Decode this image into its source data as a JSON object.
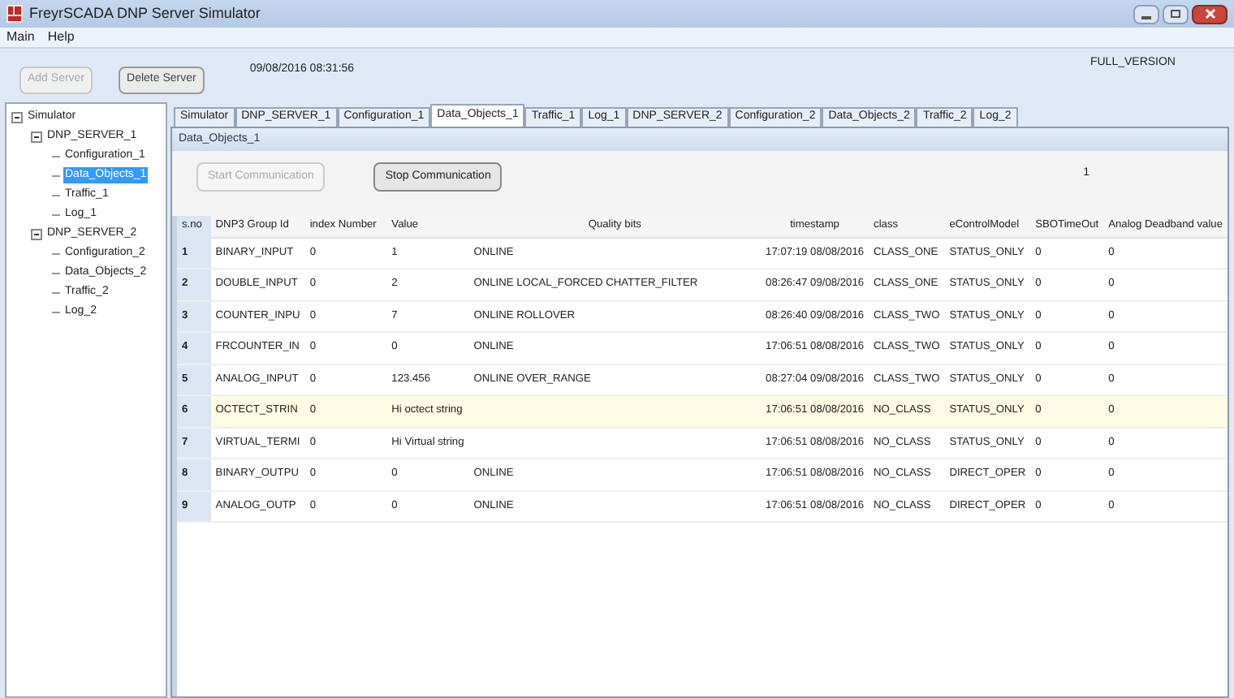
{
  "window": {
    "title": "FreyrSCADA DNP Server Simulator"
  },
  "menu": [
    "Main",
    "Help"
  ],
  "toolbar": {
    "buttons": [
      {
        "label": "Add Server",
        "disabled": true
      },
      {
        "label": "Delete Server",
        "disabled": false
      }
    ],
    "datetime": "09/08/2016 08:31:56",
    "version": "FULL_VERSION"
  },
  "tree": [
    {
      "label": "Simulator",
      "expanded": true,
      "selected": false,
      "children": [
        {
          "label": "DNP_SERVER_1",
          "expanded": true,
          "selected": false,
          "children": [
            {
              "label": "Configuration_1",
              "selected": false
            },
            {
              "label": "Data_Objects_1",
              "selected": true
            },
            {
              "label": "Traffic_1",
              "selected": false
            },
            {
              "label": "Log_1",
              "selected": false
            }
          ]
        },
        {
          "label": "DNP_SERVER_2",
          "expanded": true,
          "selected": false,
          "children": [
            {
              "label": "Configuration_2",
              "selected": false
            },
            {
              "label": "Data_Objects_2",
              "selected": false
            },
            {
              "label": "Traffic_2",
              "selected": false
            },
            {
              "label": "Log_2",
              "selected": false
            }
          ]
        }
      ]
    }
  ],
  "tabs": [
    {
      "label": "Simulator",
      "selected": false
    },
    {
      "label": "DNP_SERVER_1",
      "selected": false
    },
    {
      "label": "Configuration_1",
      "selected": false
    },
    {
      "label": "Data_Objects_1",
      "selected": true
    },
    {
      "label": "Traffic_1",
      "selected": false
    },
    {
      "label": "Log_1",
      "selected": false
    },
    {
      "label": "DNP_SERVER_2",
      "selected": false
    },
    {
      "label": "Configuration_2",
      "selected": false
    },
    {
      "label": "Data_Objects_2",
      "selected": false
    },
    {
      "label": "Traffic_2",
      "selected": false
    },
    {
      "label": "Log_2",
      "selected": false
    }
  ],
  "panel": {
    "title": "Data_Objects_1",
    "buttons": [
      {
        "label": "Start Communication",
        "disabled": true
      },
      {
        "label": "Stop Communication",
        "disabled": false
      }
    ],
    "counter": "1"
  },
  "table": {
    "columns": [
      "s.no",
      "DNP3 Group Id",
      "index Number",
      "Value",
      "Quality bits",
      "timestamp",
      "class",
      "eControlModel",
      "SBOTimeOut",
      "Analog Deadband value"
    ],
    "rows": [
      {
        "cells": [
          "1",
          "BINARY_INPUT",
          "0",
          "1",
          "ONLINE",
          "17:07:19 08/08/2016",
          "CLASS_ONE",
          "STATUS_ONLY",
          "0",
          "0"
        ],
        "selected": false
      },
      {
        "cells": [
          "2",
          "DOUBLE_INPUT",
          "0",
          "2",
          "ONLINE LOCAL_FORCED CHATTER_FILTER",
          "08:26:47 09/08/2016",
          "CLASS_ONE",
          "STATUS_ONLY",
          "0",
          "0"
        ],
        "selected": false
      },
      {
        "cells": [
          "3",
          "COUNTER_INPU",
          "0",
          "7",
          "ONLINE ROLLOVER",
          "08:26:40 09/08/2016",
          "CLASS_TWO",
          "STATUS_ONLY",
          "0",
          "0"
        ],
        "selected": false
      },
      {
        "cells": [
          "4",
          "FRCOUNTER_IN",
          "0",
          "0",
          "ONLINE",
          "17:06:51 08/08/2016",
          "CLASS_TWO",
          "STATUS_ONLY",
          "0",
          "0"
        ],
        "selected": false
      },
      {
        "cells": [
          "5",
          "ANALOG_INPUT",
          "0",
          "123.456",
          "ONLINE OVER_RANGE",
          "08:27:04 09/08/2016",
          "CLASS_TWO",
          "STATUS_ONLY",
          "0",
          "0"
        ],
        "selected": false
      },
      {
        "cells": [
          "6",
          "OCTECT_STRIN",
          "0",
          "Hi octect string",
          "",
          "17:06:51 08/08/2016",
          "NO_CLASS",
          "STATUS_ONLY",
          "0",
          "0"
        ],
        "selected": true
      },
      {
        "cells": [
          "7",
          "VIRTUAL_TERMI",
          "0",
          "Hi Virtual string",
          "",
          "17:06:51 08/08/2016",
          "NO_CLASS",
          "STATUS_ONLY",
          "0",
          "0"
        ],
        "selected": false
      },
      {
        "cells": [
          "8",
          "BINARY_OUTPU",
          "0",
          "0",
          "ONLINE",
          "17:06:51 08/08/2016",
          "NO_CLASS",
          "DIRECT_OPER",
          "0",
          "0"
        ],
        "selected": false
      },
      {
        "cells": [
          "9",
          "ANALOG_OUTP",
          "0",
          "0",
          "ONLINE",
          "17:06:51 08/08/2016",
          "NO_CLASS",
          "DIRECT_OPER",
          "0",
          "0"
        ],
        "selected": false
      }
    ]
  }
}
